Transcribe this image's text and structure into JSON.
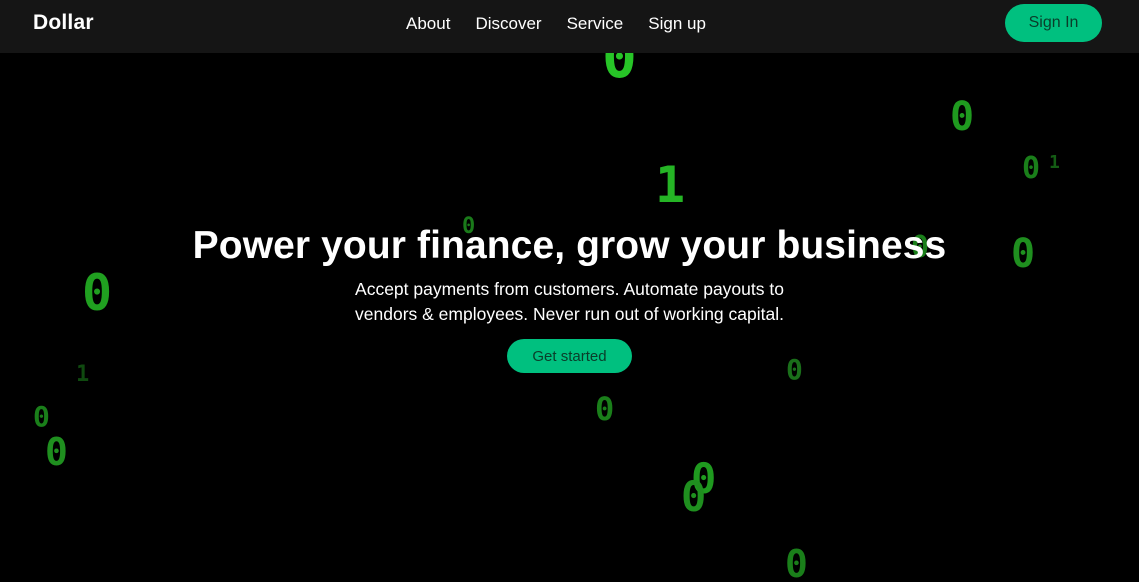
{
  "nav": {
    "brand": "Dollar",
    "links": [
      "About",
      "Discover",
      "Service",
      "Sign up"
    ],
    "signin_label": "Sign In"
  },
  "hero": {
    "title": "Power your finance, grow your business",
    "subtitle": "Accept payments from customers. Automate payouts to vendors & employees. Never run out of working capital.",
    "cta_label": "Get started"
  },
  "theme": {
    "background": "#000000",
    "navbar_bg": "#151515",
    "accent": "#00c07f",
    "digit_color": "#1fa81f"
  },
  "background_digits": [
    "0",
    "0",
    "1",
    "0",
    "0",
    "0",
    "0",
    "1",
    "0",
    "0",
    "0",
    "0",
    "0",
    "0",
    "0",
    "0",
    "1"
  ]
}
